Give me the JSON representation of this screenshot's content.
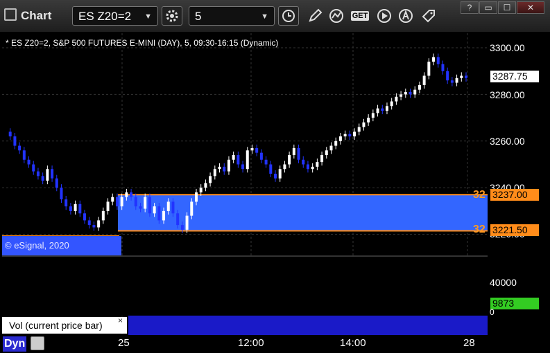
{
  "app": {
    "title": "Chart"
  },
  "toolbar": {
    "symbol": "ES Z20=2",
    "interval": "5",
    "icons": [
      "settings-gear-icon",
      "clock-icon",
      "pencil-icon",
      "study-icon",
      "get-icon",
      "play-icon",
      "alert-icon",
      "tag-icon"
    ],
    "get_label": "GET"
  },
  "window": {
    "help": "?",
    "restore": "▭",
    "maximize": "☐",
    "close": "✕"
  },
  "chart": {
    "header": "* ES Z20=2, S&P 500 FUTURES E-MINI (DAY), 5, 09:30-16:15 (Dynamic)",
    "copyright": "© eSignal, 2020",
    "price_ticks": [
      "3300.00",
      "3280.00",
      "3260.00",
      "3240.00",
      "3220.00"
    ],
    "last_price": "3287.75",
    "upper_level": "3237.00",
    "lower_level": "3221.50",
    "upper_level_label": "32",
    "lower_level_label": "32",
    "colors": {
      "up": "#ffffff",
      "down": "#2233ff",
      "zone": "#3366ff",
      "zone_line": "#ff8c1a",
      "vol_up": "#22cc22",
      "vol_down": "#cc2222"
    }
  },
  "volume": {
    "label": "Vol (current price bar)",
    "close": "×",
    "tick": "40000",
    "current": "9873",
    "zero": "0"
  },
  "time_axis": {
    "ticks": [
      "25",
      "12:00",
      "14:00",
      "28"
    ],
    "dyn_label": "Dyn"
  },
  "chart_data": {
    "type": "candlestick",
    "symbol": "ES Z20=2",
    "interval": "5",
    "y_range": [
      3215,
      3305
    ],
    "last": 3287.75,
    "horizontal_zone": [
      3221.5,
      3237.0
    ]
  }
}
